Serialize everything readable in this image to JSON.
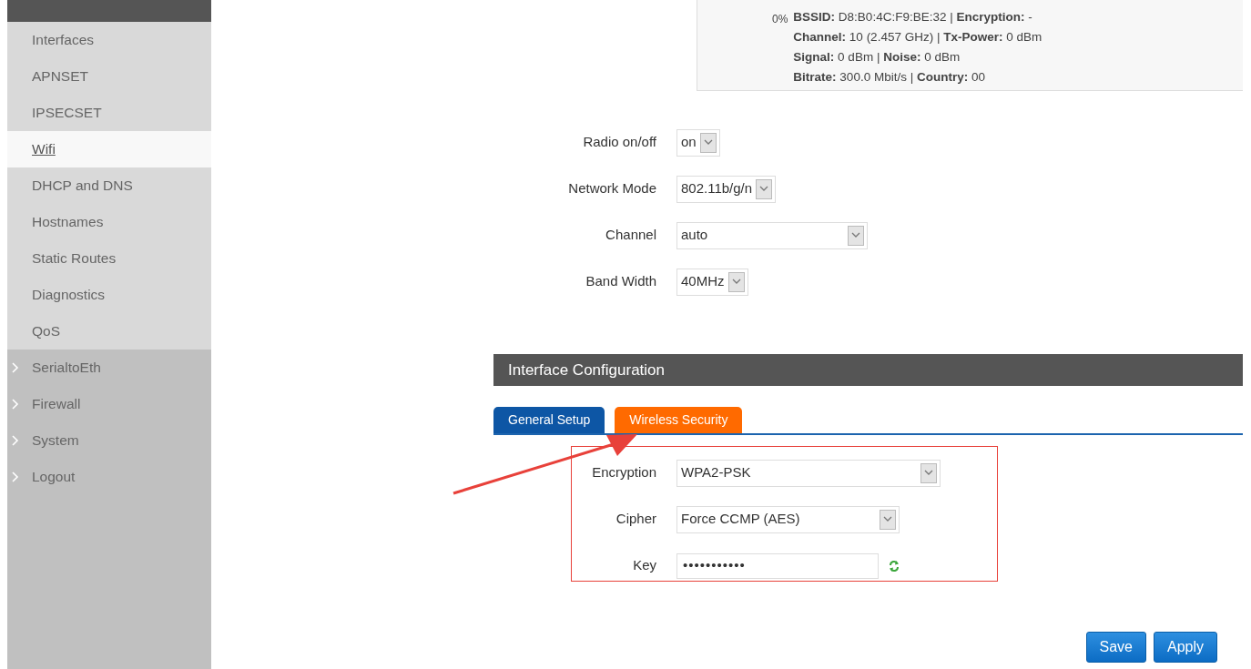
{
  "sidebar": {
    "items": [
      {
        "label": "Interfaces",
        "kind": "sub",
        "selected": false
      },
      {
        "label": "APNSET",
        "kind": "sub",
        "selected": false
      },
      {
        "label": "IPSECSET",
        "kind": "sub",
        "selected": false
      },
      {
        "label": "Wifi",
        "kind": "sub",
        "selected": true
      },
      {
        "label": "DHCP and DNS",
        "kind": "sub",
        "selected": false
      },
      {
        "label": "Hostnames",
        "kind": "sub",
        "selected": false
      },
      {
        "label": "Static Routes",
        "kind": "sub",
        "selected": false
      },
      {
        "label": "Diagnostics",
        "kind": "sub",
        "selected": false
      },
      {
        "label": "QoS",
        "kind": "sub",
        "selected": false
      },
      {
        "label": "SerialtoEth",
        "kind": "group",
        "selected": false
      },
      {
        "label": "Firewall",
        "kind": "group",
        "selected": false
      },
      {
        "label": "System",
        "kind": "group",
        "selected": false
      },
      {
        "label": "Logout",
        "kind": "group",
        "selected": false
      }
    ]
  },
  "status": {
    "percent": "0%",
    "lines": [
      "**BSSID:** D8:B0:4C:F9:BE:32 | **Encryption:** -",
      "**Channel:** 10 (2.457 GHz) | **Tx-Power:** 0 dBm",
      "**Signal:** 0 dBm | **Noise:** 0 dBm",
      "**Bitrate:** 300.0 Mbit/s | **Country:** 00"
    ]
  },
  "device_form": [
    {
      "label": "Radio on/off",
      "value": "on",
      "kind": "compact"
    },
    {
      "label": "Network Mode",
      "value": "802.11b/g/n",
      "kind": "compact"
    },
    {
      "label": "Channel",
      "value": "auto",
      "kind": "wide"
    },
    {
      "label": "Band Width",
      "value": "40MHz",
      "kind": "compact"
    }
  ],
  "section_title": "Interface Configuration",
  "tabs": [
    {
      "label": "General Setup",
      "selected": false
    },
    {
      "label": "Wireless Security",
      "selected": true
    }
  ],
  "security_form": [
    {
      "label": "Encryption",
      "value": "WPA2-PSK",
      "kind": "select"
    },
    {
      "label": "Cipher",
      "value": "Force CCMP (AES)",
      "kind": "select"
    },
    {
      "label": "Key",
      "value": "•••••••••••",
      "kind": "password"
    }
  ],
  "buttons": [
    "Save",
    "Apply"
  ]
}
